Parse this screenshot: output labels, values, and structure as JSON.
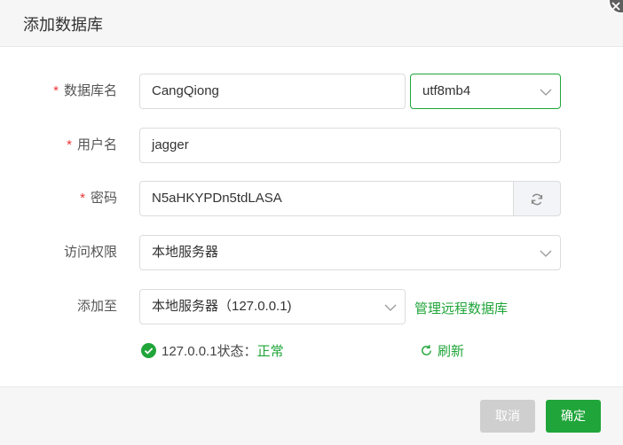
{
  "dialog": {
    "title": "添加数据库"
  },
  "fields": {
    "dbname": {
      "required": "*",
      "label": "数据库名",
      "value": "CangQiong"
    },
    "charset": {
      "value": "utf8mb4"
    },
    "username": {
      "required": "*",
      "label": "用户名",
      "value": "jagger"
    },
    "password": {
      "required": "*",
      "label": "密码",
      "value": "N5aHKYPDn5tdLASA"
    },
    "access": {
      "label": "访问权限",
      "value": "本地服务器"
    },
    "add_to": {
      "label": "添加至",
      "value": "本地服务器（127.0.0.1)",
      "link": "管理远程数据库"
    }
  },
  "status": {
    "prefix": "127.0.0.1状态：",
    "state": "正常",
    "refresh": "刷新"
  },
  "footer": {
    "cancel": "取消",
    "confirm": "确定"
  },
  "colors": {
    "accent": "#20a53a",
    "required": "#e33333",
    "disabled": "#cfcfcf"
  }
}
